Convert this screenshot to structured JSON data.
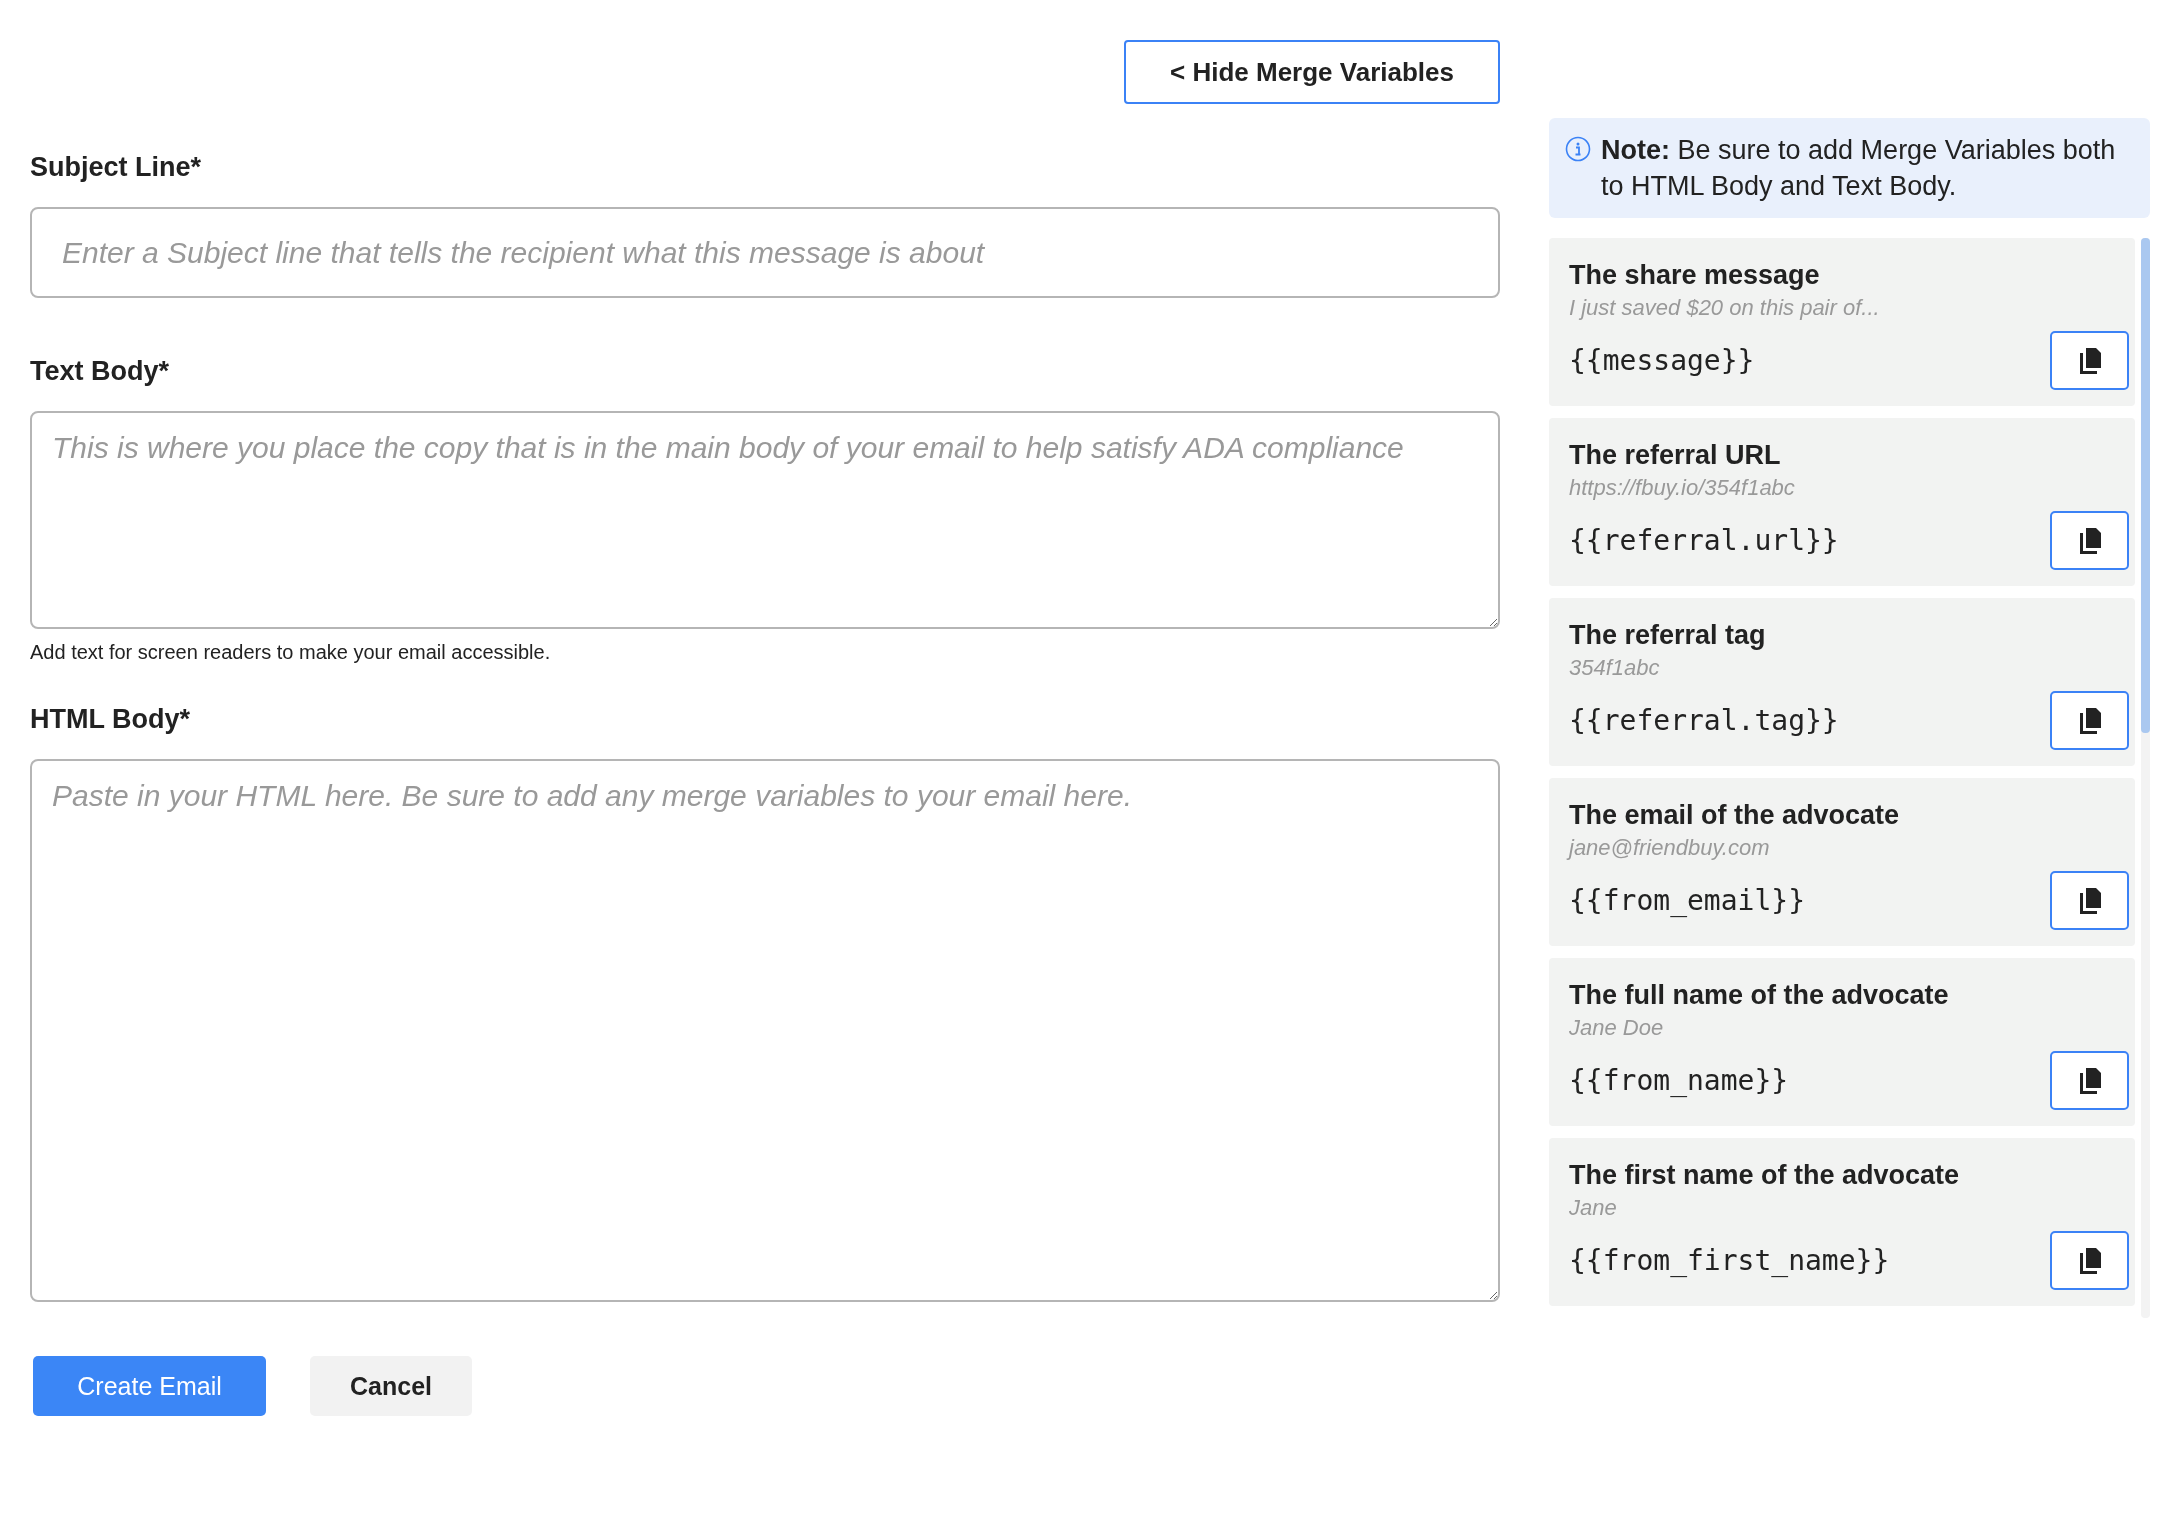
{
  "toggle_button": {
    "label": "< Hide Merge Variables"
  },
  "form": {
    "fields": [
      {
        "kind": "input",
        "label": "Subject Line*",
        "placeholder": "Enter a Subject line that tells the recipient what this message is about"
      },
      {
        "kind": "textarea",
        "label": "Text Body*",
        "placeholder": "This is where you place the copy that is in the main body of your email to help satisfy ADA compliance",
        "help": "Add text for screen readers to make your email accessible."
      },
      {
        "kind": "textarea_large",
        "label": "HTML Body*",
        "placeholder": "Paste in your HTML here. Be sure to add any merge variables to your email here."
      }
    ],
    "buttons": [
      {
        "kind": "primary",
        "label": "Create Email"
      },
      {
        "kind": "secondary",
        "label": "Cancel"
      }
    ]
  },
  "merge_panel": {
    "note": "**Note:** Be sure to add Merge Variables both to HTML Body and Text Body.",
    "variables": [
      {
        "title": "The share message",
        "example": "I just saved $20 on this pair of...",
        "token": "{{message}}"
      },
      {
        "title": "The referral URL",
        "example": "https://fbuy.io/354f1abc",
        "token": "{{referral.url}}"
      },
      {
        "title": "The referral tag",
        "example": "354f1abc",
        "token": "{{referral.tag}}"
      },
      {
        "title": "The email of the advocate",
        "example": "jane@friendbuy.com",
        "token": "{{from_email}}"
      },
      {
        "title": "The full name of the advocate",
        "example": "Jane Doe",
        "token": "{{from_name}}"
      },
      {
        "title": "The first name of the advocate",
        "example": "Jane",
        "token": "{{from_first_name}}"
      }
    ]
  }
}
